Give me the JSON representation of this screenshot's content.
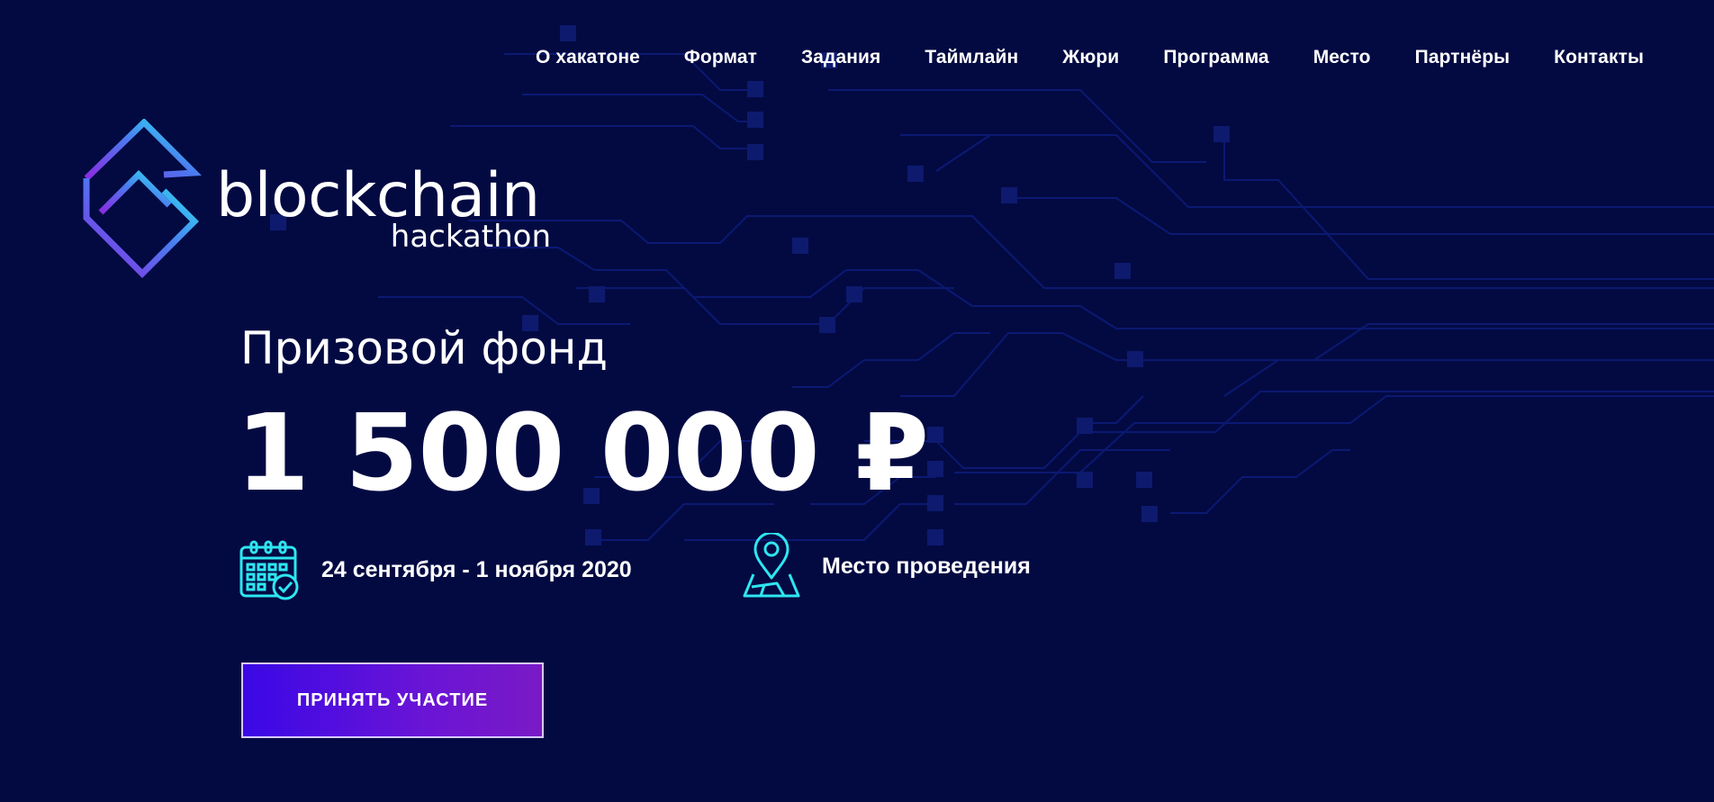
{
  "nav": {
    "items": [
      {
        "label": "О хакатоне"
      },
      {
        "label": "Формат"
      },
      {
        "label": "Задания"
      },
      {
        "label": "Таймлайн"
      },
      {
        "label": "Жюри"
      },
      {
        "label": "Программа"
      },
      {
        "label": "Место"
      },
      {
        "label": "Партнёры"
      },
      {
        "label": "Контакты"
      }
    ]
  },
  "logo": {
    "word": "blockchain",
    "sub": "hackathon"
  },
  "hero": {
    "prize_label": "Призовой фонд",
    "prize_amount": "1 500 000 ₽",
    "dates": "24 сентября - 1 ноября 2020",
    "place": "Место проведения",
    "cta_label": "ПРИНЯТЬ УЧАСТИЕ"
  },
  "icons": {
    "logo": "blockchain-diamond-logo-icon",
    "dates": "calendar-check-icon",
    "place": "map-pin-icon"
  },
  "colors": {
    "background": "#030a42",
    "accent_cyan": "#2ee6f0",
    "accent_purple": "#7a1ac6",
    "cta_start": "#3a08e6",
    "cta_end": "#7a1ac6"
  }
}
